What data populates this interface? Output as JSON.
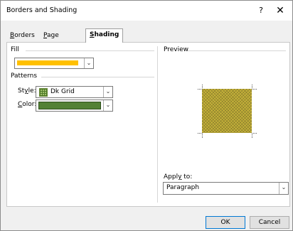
{
  "window": {
    "title": "Borders and Shading",
    "help_glyph": "?",
    "close_glyph": "✕"
  },
  "tabs": [
    {
      "label": "Borders",
      "accel": "B",
      "rest": "orders"
    },
    {
      "label": "Page Border",
      "accel": "P",
      "rest": "age Border"
    },
    {
      "label": "Shading",
      "accel": "S",
      "rest": "hading",
      "active": true
    }
  ],
  "fill": {
    "label": "Fill",
    "color": "#FFC000"
  },
  "patterns": {
    "label": "Patterns",
    "style_label_pre": "St",
    "style_label_accel": "y",
    "style_label_post": "le:",
    "style_value": "Dk Grid",
    "color_label_accel": "C",
    "color_label_post": "olor:",
    "color_value": "#538135"
  },
  "preview": {
    "label": "Preview"
  },
  "apply": {
    "label_pre": "Appl",
    "label_accel": "y",
    "label_post": " to:",
    "value": "Paragraph"
  },
  "buttons": {
    "ok": "OK",
    "cancel": "Cancel"
  },
  "icons": {
    "dropdown": "chevron-down-icon"
  }
}
